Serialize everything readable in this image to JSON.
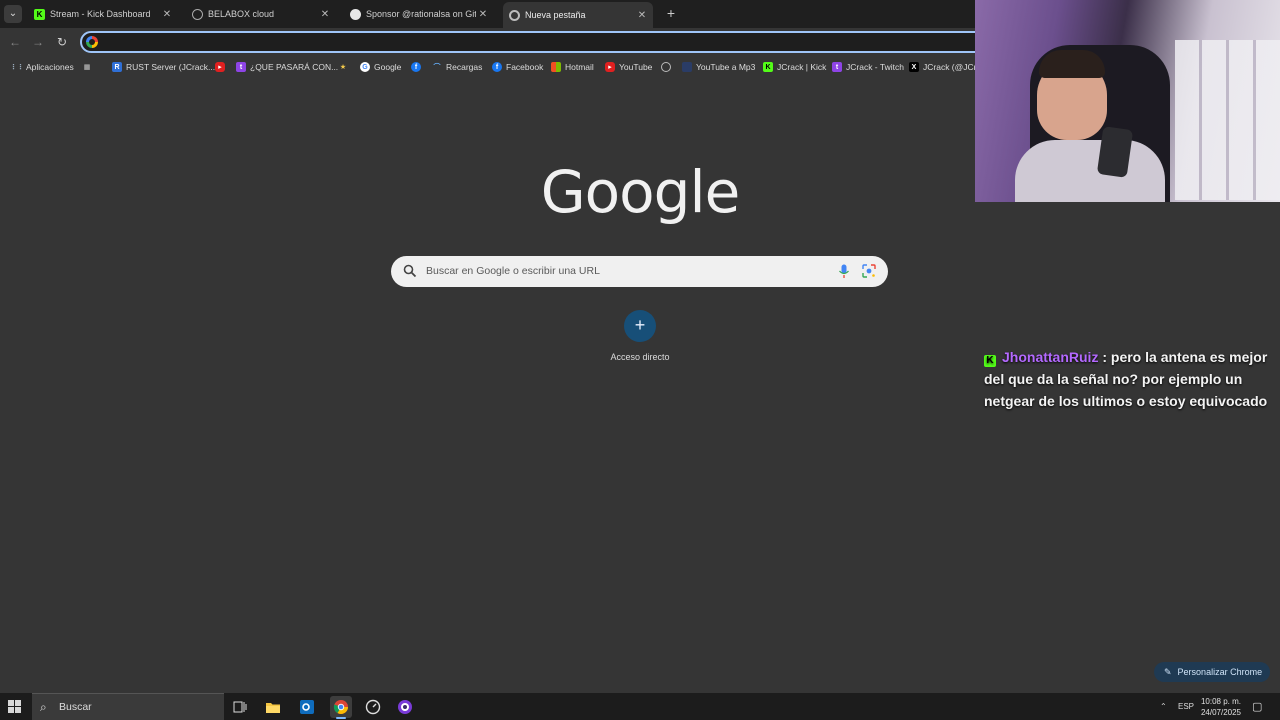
{
  "tabs": [
    {
      "title": "Stream - Kick Dashboard",
      "icon": "kick-icon"
    },
    {
      "title": "BELABOX cloud",
      "icon": "globe-icon"
    },
    {
      "title": "Sponsor @rationalsa on GitHub",
      "icon": "github-icon"
    },
    {
      "title": "Nueva pestaña",
      "icon": "chrome-tab-icon",
      "active": true
    }
  ],
  "toolbar": {
    "address_value": ""
  },
  "bookmarks": [
    {
      "label": "Aplicaciones",
      "icon": "apps-grid-icon"
    },
    {
      "label": "",
      "icon": "grid-icon"
    },
    {
      "label": "RUST Server (JCrack...",
      "icon": "rust-icon"
    },
    {
      "label": "",
      "icon": "youtube-icon"
    },
    {
      "label": "¿QUE PASARÁ CON...",
      "icon": "twitch-icon"
    },
    {
      "label": "",
      "icon": "star-icon"
    },
    {
      "label": "Google",
      "icon": "google-icon"
    },
    {
      "label": "",
      "icon": "facebook-icon"
    },
    {
      "label": "Recargas",
      "icon": "recargas-icon"
    },
    {
      "label": "Facebook",
      "icon": "facebook-icon"
    },
    {
      "label": "Hotmail",
      "icon": "microsoft-icon"
    },
    {
      "label": "YouTube",
      "icon": "youtube-icon"
    },
    {
      "label": "",
      "icon": "globe-icon"
    },
    {
      "label": "YouTube a Mp3",
      "icon": "mp3-icon"
    },
    {
      "label": "JCrack | Kick",
      "icon": "kick-icon"
    },
    {
      "label": "JCrack - Twitch",
      "icon": "twitch-icon"
    },
    {
      "label": "JCrack (@JCra",
      "icon": "x-icon"
    }
  ],
  "main": {
    "logo": "Google",
    "search_placeholder": "Buscar en Google o escribir una URL",
    "shortcut_label": "Acceso directo",
    "customize_label": "Personalizar Chrome"
  },
  "chat": {
    "username": "JhonattanRuiz",
    "message": " : pero la antena es mejor del que da la señal no? por ejemplo un netgear de los ultimos o estoy equivocado"
  },
  "taskbar": {
    "search_label": "Buscar",
    "language": "ESP",
    "time": "10:08 p. m.",
    "date": "24/07/2025"
  },
  "colors": {
    "accent": "#9fc5f8",
    "kick_green": "#53fc18",
    "chat_username": "#b469ff"
  }
}
